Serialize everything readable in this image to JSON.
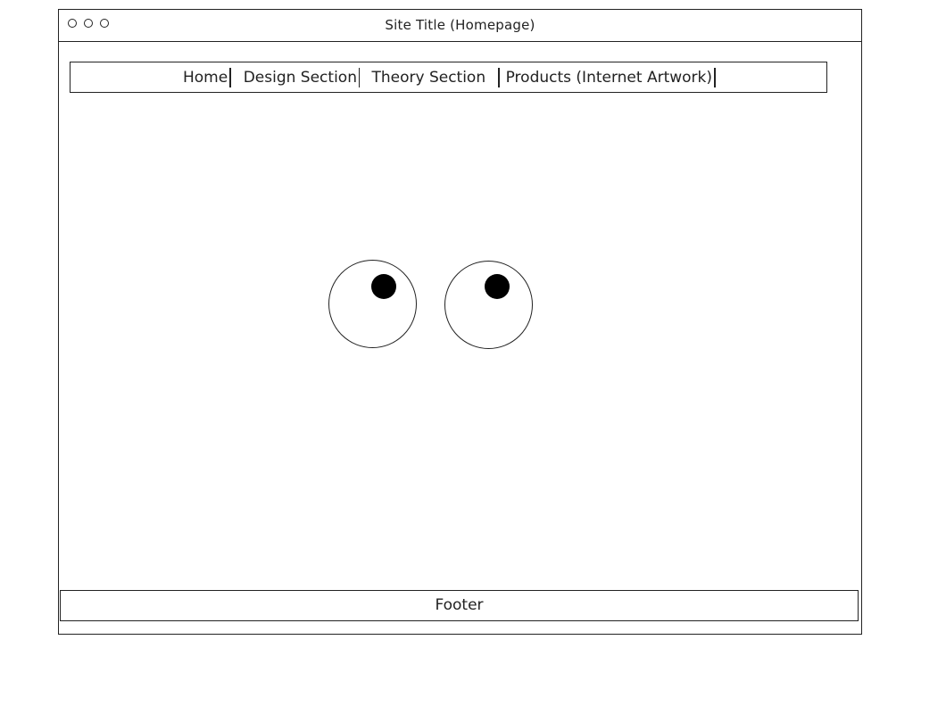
{
  "window": {
    "title": "Site Title (Homepage)"
  },
  "nav": {
    "items": [
      {
        "label": "Home"
      },
      {
        "label": "Design Section"
      },
      {
        "label": "Theory Section"
      },
      {
        "label": "Products (Internet Artwork)"
      }
    ]
  },
  "footer": {
    "label": "Footer"
  }
}
